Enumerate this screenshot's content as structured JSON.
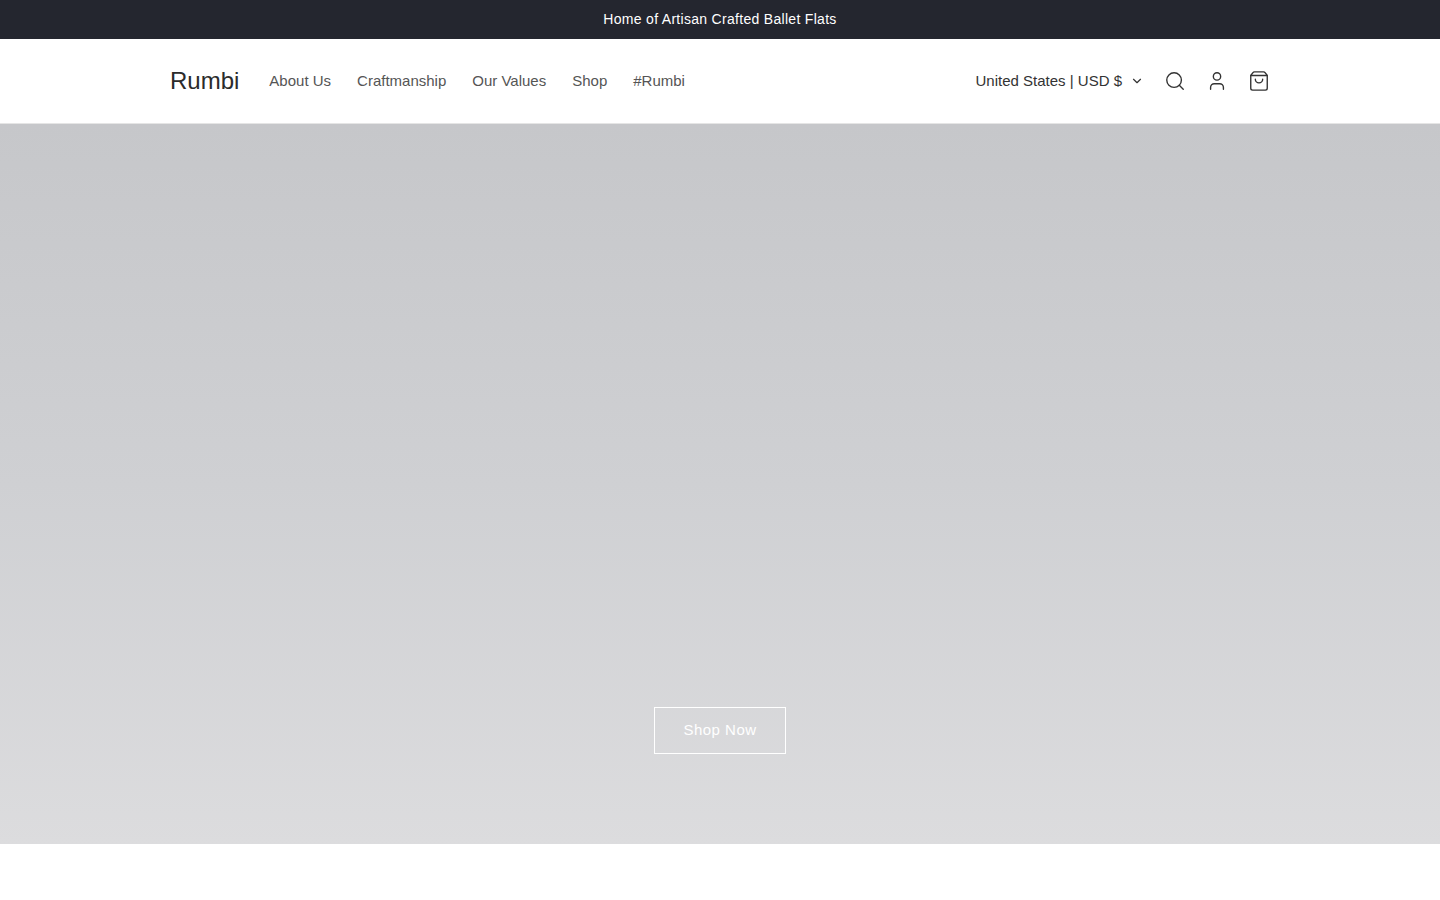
{
  "announcement": "Home of Artisan Crafted Ballet Flats",
  "header": {
    "logo": "Rumbi",
    "nav": [
      {
        "label": "About Us",
        "selected": false
      },
      {
        "label": "Craftmanship",
        "selected": false
      },
      {
        "label": "Our Values",
        "selected": false
      },
      {
        "label": "Shop",
        "selected": false
      },
      {
        "label": "#Rumbi",
        "selected": false
      }
    ],
    "country_selector": "United States | USD $"
  },
  "hero": {
    "button": "Shop Now"
  }
}
